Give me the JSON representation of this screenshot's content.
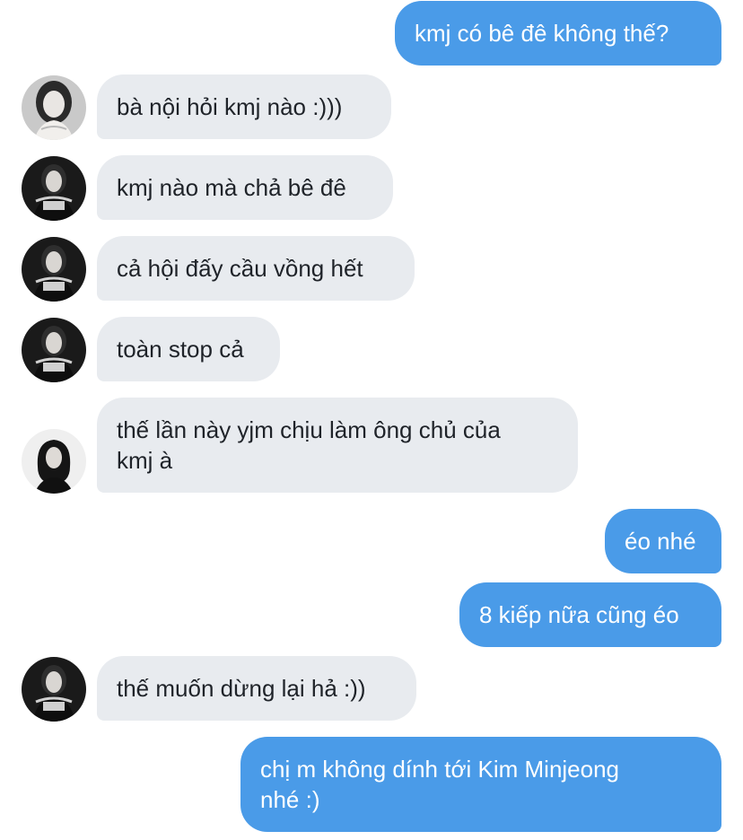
{
  "conversation": {
    "messages": [
      {
        "sender": "me",
        "text": "kmj có bê đê không thế?"
      },
      {
        "sender": "other",
        "avatar": "avatar-light-portrait",
        "text": "bà nội hỏi kmj nào :)))"
      },
      {
        "sender": "other",
        "avatar": "avatar-dark-portrait",
        "text": "kmj nào mà chả bê đê"
      },
      {
        "sender": "other",
        "avatar": "avatar-dark-portrait",
        "text": "cả hội đấy cầu vồng hết"
      },
      {
        "sender": "other",
        "avatar": "avatar-dark-portrait",
        "text": "toàn stop cả"
      },
      {
        "sender": "other",
        "avatar": "avatar-hooded-portrait",
        "text": "thế lần này yjm chịu làm ông chủ của\nkmj à"
      },
      {
        "sender": "me",
        "text": "éo nhé"
      },
      {
        "sender": "me",
        "text": "8 kiếp nữa cũng éo"
      },
      {
        "sender": "other",
        "avatar": "avatar-dark-portrait",
        "text": "thế muốn dừng lại hả :))"
      },
      {
        "sender": "me",
        "text": "chị m không dính tới Kim Minjeong\nnhé :)"
      }
    ]
  },
  "colors": {
    "outgoing_bubble": "#4a9be8",
    "incoming_bubble": "#e8ebef",
    "outgoing_text": "#ffffff",
    "incoming_text": "#1f2329"
  }
}
